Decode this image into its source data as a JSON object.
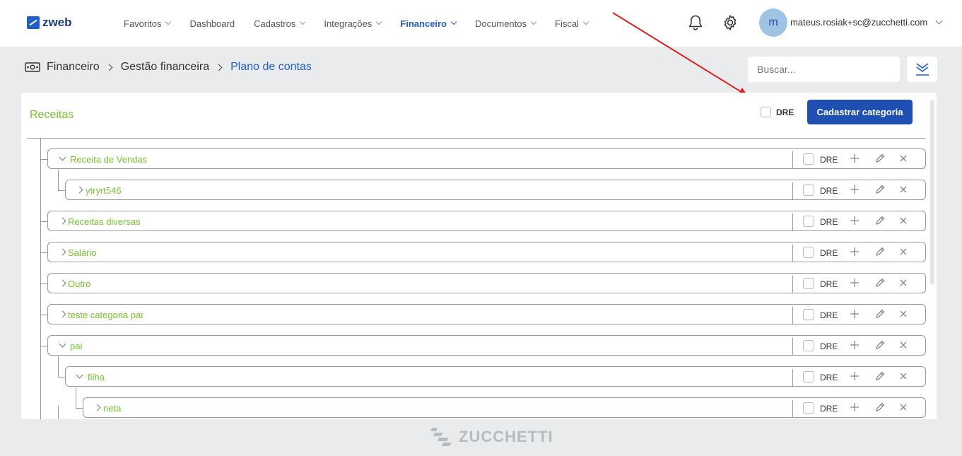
{
  "brand": {
    "logo_text": "zweb"
  },
  "nav": {
    "items": [
      {
        "label": "Favoritos",
        "dropdown": true,
        "active": false
      },
      {
        "label": "Dashboard",
        "dropdown": false,
        "active": false
      },
      {
        "label": "Cadastros",
        "dropdown": true,
        "active": false
      },
      {
        "label": "Integrações",
        "dropdown": true,
        "active": false
      },
      {
        "label": "Financeiro",
        "dropdown": true,
        "active": true
      },
      {
        "label": "Documentos",
        "dropdown": true,
        "active": false
      },
      {
        "label": "Fiscal",
        "dropdown": true,
        "active": false
      }
    ]
  },
  "user": {
    "avatar_initial": "m",
    "email": "mateus.rosiak+sc@zucchetti.com"
  },
  "icons": {
    "notifications": "bell-icon",
    "settings": "gear-icon",
    "breadcrumb": "money-icon",
    "export": "download-icon"
  },
  "breadcrumb": {
    "level1": "Financeiro",
    "level2": "Gestão financeira",
    "current": "Plano de contas"
  },
  "search": {
    "placeholder": "Buscar..."
  },
  "panel": {
    "title": "Receitas",
    "dre_label": "DRE",
    "dre_checked": false,
    "add_button": "Cadastrar categoria"
  },
  "categories": [
    {
      "label": "Receita de Vendas",
      "level": 0,
      "expanded": true,
      "dre_label": "DRE",
      "dre_checked": false
    },
    {
      "label": "ytryrt546",
      "level": 1,
      "expanded": false,
      "dre_label": "DRE",
      "dre_checked": false
    },
    {
      "label": "Receitas diversas",
      "level": 0,
      "expanded": false,
      "dre_label": "DRE",
      "dre_checked": false
    },
    {
      "label": "Salário",
      "level": 0,
      "expanded": false,
      "dre_label": "DRE",
      "dre_checked": false
    },
    {
      "label": "Outro",
      "level": 0,
      "expanded": false,
      "dre_label": "DRE",
      "dre_checked": false
    },
    {
      "label": "teste categoria pai",
      "level": 0,
      "expanded": false,
      "dre_label": "DRE",
      "dre_checked": false
    },
    {
      "label": "pai",
      "level": 0,
      "expanded": true,
      "dre_label": "DRE",
      "dre_checked": false
    },
    {
      "label": "filha",
      "level": 1,
      "expanded": true,
      "dre_label": "DRE",
      "dre_checked": false
    },
    {
      "label": "neta",
      "level": 2,
      "expanded": false,
      "dre_label": "DRE",
      "dre_checked": false
    }
  ],
  "row_actions": [
    "plus-icon",
    "pencil-icon",
    "close-icon"
  ],
  "footer": {
    "brand": "ZUCCHETTI"
  },
  "colors": {
    "primary": "#1f4fb0",
    "accent_green": "#76c32e",
    "page_bg": "#e9ebec",
    "annotation_arrow": "#e02020"
  }
}
